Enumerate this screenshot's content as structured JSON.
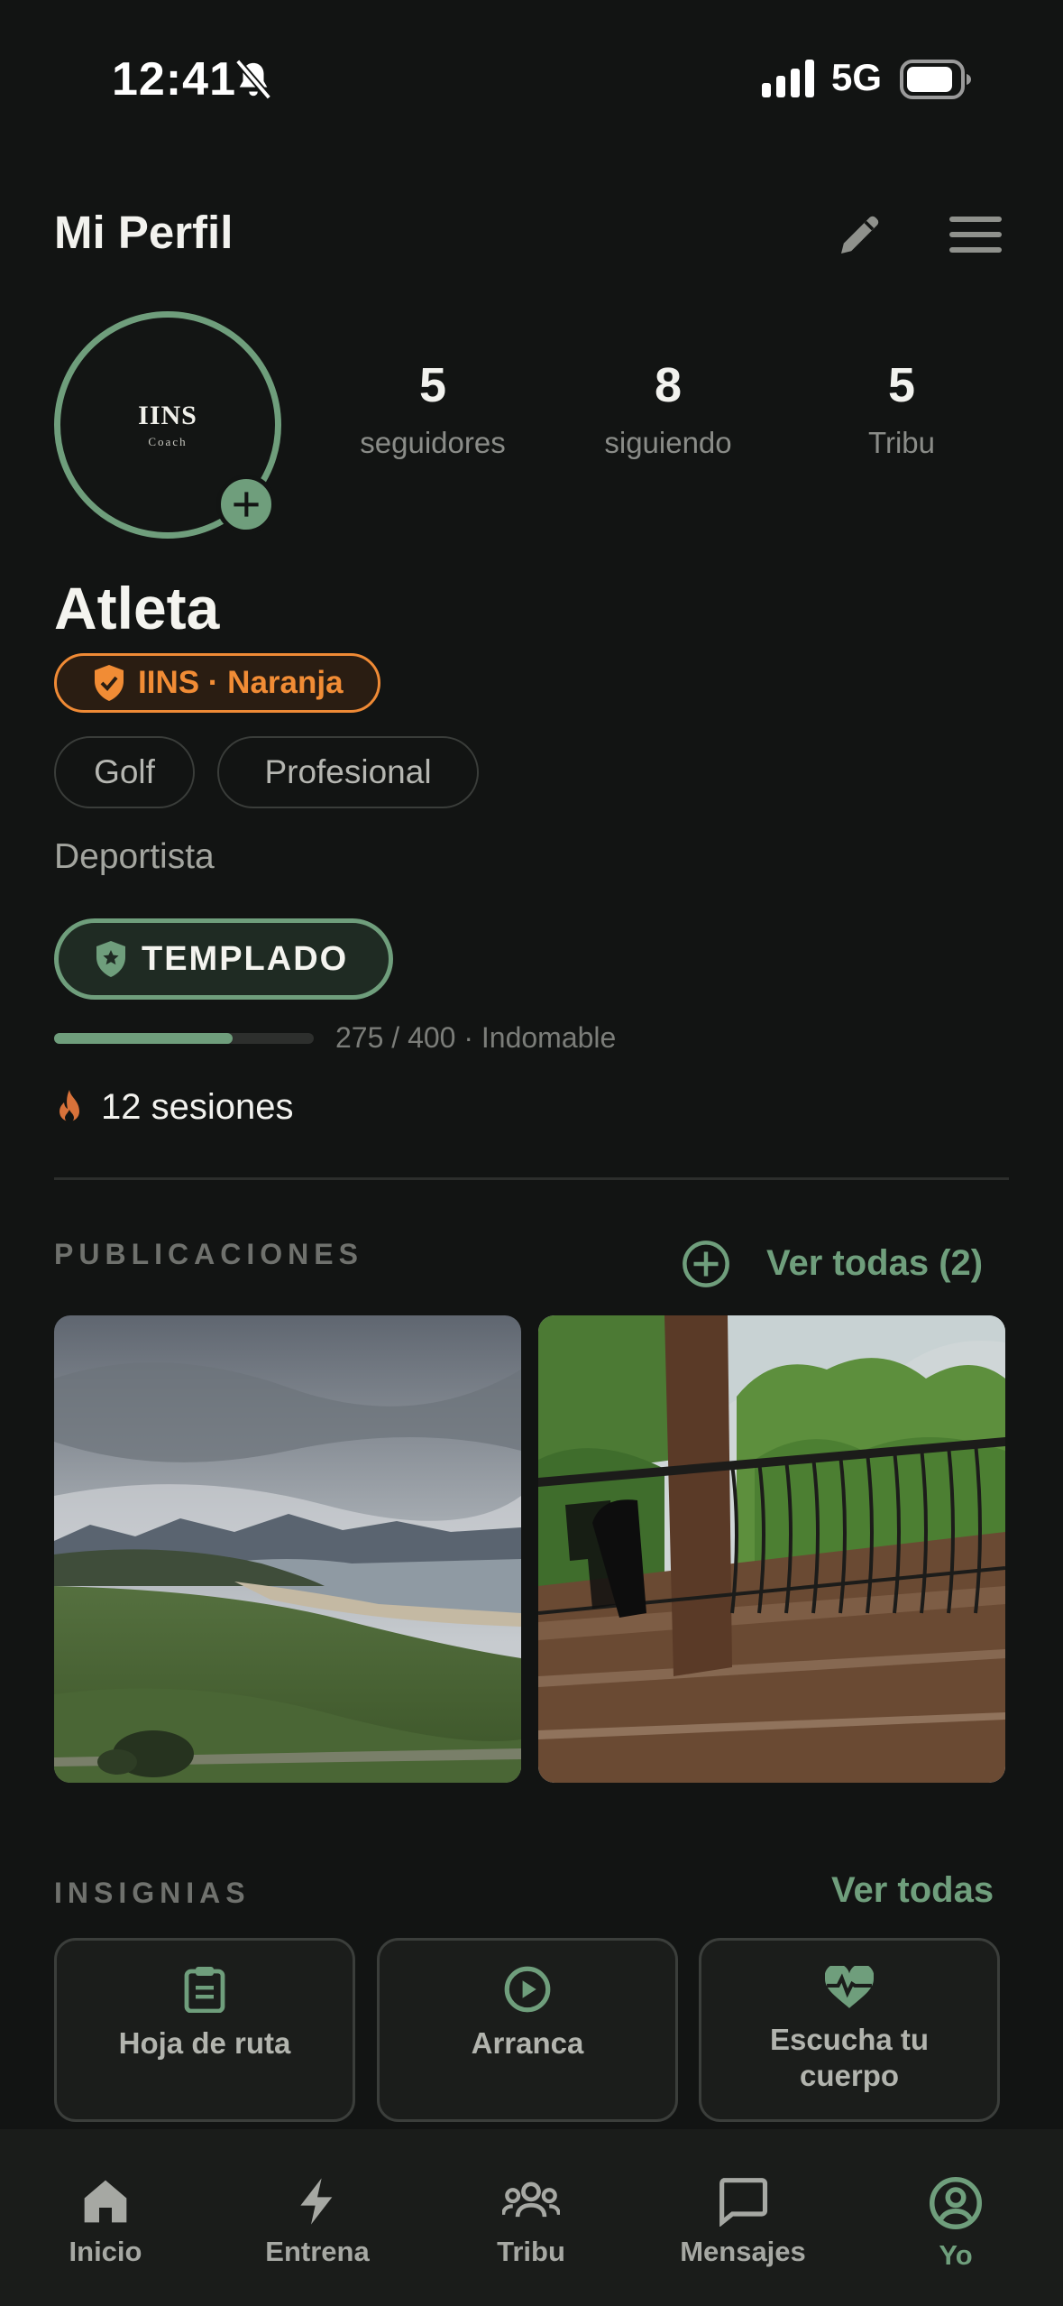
{
  "status_bar": {
    "time": "12:41",
    "network": "5G"
  },
  "header": {
    "title": "Mi Perfil"
  },
  "avatar": {
    "name": "IINS",
    "sub": "Coach"
  },
  "stats": [
    {
      "value": "5",
      "label": "seguidores"
    },
    {
      "value": "8",
      "label": "siguiendo"
    },
    {
      "value": "5",
      "label": "Tribu"
    }
  ],
  "profile": {
    "display_name": "Atleta",
    "team_badge": "IINS · Naranja",
    "tags": [
      "Golf",
      "Profesional"
    ],
    "role": "Deportista",
    "level": "TEMPLADO",
    "progress_fraction": 0.6875,
    "progress_text": "275 / 400 · Indomable",
    "sessions": "12 sesiones"
  },
  "publications": {
    "title": "PUBLICACIONES",
    "see_all": "Ver todas (2)"
  },
  "badges": {
    "title": "INSIGNIAS",
    "see_all": "Ver todas",
    "items": [
      {
        "label": "Hoja de ruta",
        "icon": "clipboard-icon"
      },
      {
        "label": "Arranca",
        "icon": "play-circle-icon"
      },
      {
        "label": "Escucha tu cuerpo",
        "icon": "heart-pulse-icon"
      }
    ]
  },
  "nav": [
    {
      "label": "Inicio",
      "icon": "home-icon"
    },
    {
      "label": "Entrena",
      "icon": "bolt-icon"
    },
    {
      "label": "Tribu",
      "icon": "group-icon"
    },
    {
      "label": "Mensajes",
      "icon": "chat-icon"
    },
    {
      "label": "Yo",
      "icon": "user-circle-icon"
    }
  ],
  "colors": {
    "accent": "#6f9e7c",
    "team": "#f18c35",
    "background": "#121413"
  }
}
